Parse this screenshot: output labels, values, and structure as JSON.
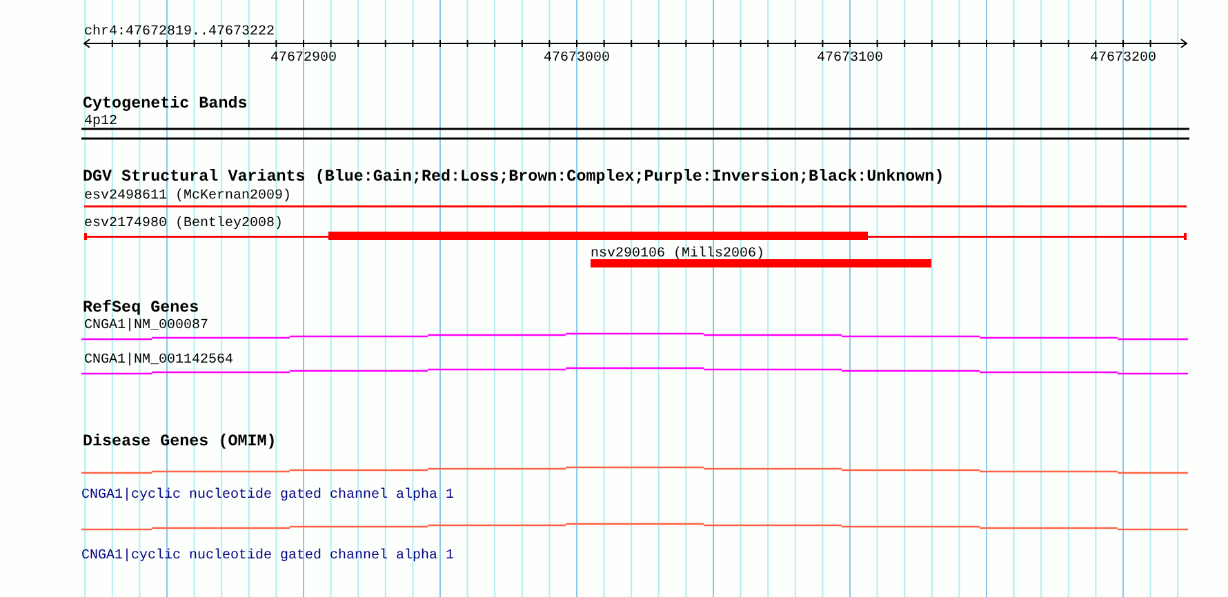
{
  "ruler": {
    "region": "chr4:47672819..47673222",
    "ticks": [
      "47672900",
      "47673000",
      "47673100",
      "47673200"
    ]
  },
  "tracks": [
    {
      "kind": "bands",
      "title": "Cytogenetic Bands",
      "features": [
        {
          "label": "4p12"
        }
      ]
    },
    {
      "kind": "variants",
      "title": "DGV Structural Variants (Blue:Gain;Red:Loss;Brown:Complex;Purple:Inversion;Black:Unknown)",
      "features": [
        {
          "label": "esv2498611 (McKernan2009)",
          "color": "#ff0000"
        },
        {
          "label": "esv2174980 (Bentley2008)",
          "color": "#ff0000"
        },
        {
          "label": "nsv290106 (Mills2006)",
          "color": "#ff0000"
        }
      ]
    },
    {
      "kind": "genes",
      "title": "RefSeq Genes",
      "features": [
        {
          "label": "CNGA1|NM_000087"
        },
        {
          "label": "CNGA1|NM_001142564"
        }
      ]
    },
    {
      "kind": "disease",
      "title": "Disease Genes (OMIM)",
      "features": [
        {
          "label": "CNGA1|cyclic nucleotide gated channel alpha 1"
        },
        {
          "label": "CNGA1|cyclic nucleotide gated channel alpha 1"
        }
      ]
    }
  ]
}
